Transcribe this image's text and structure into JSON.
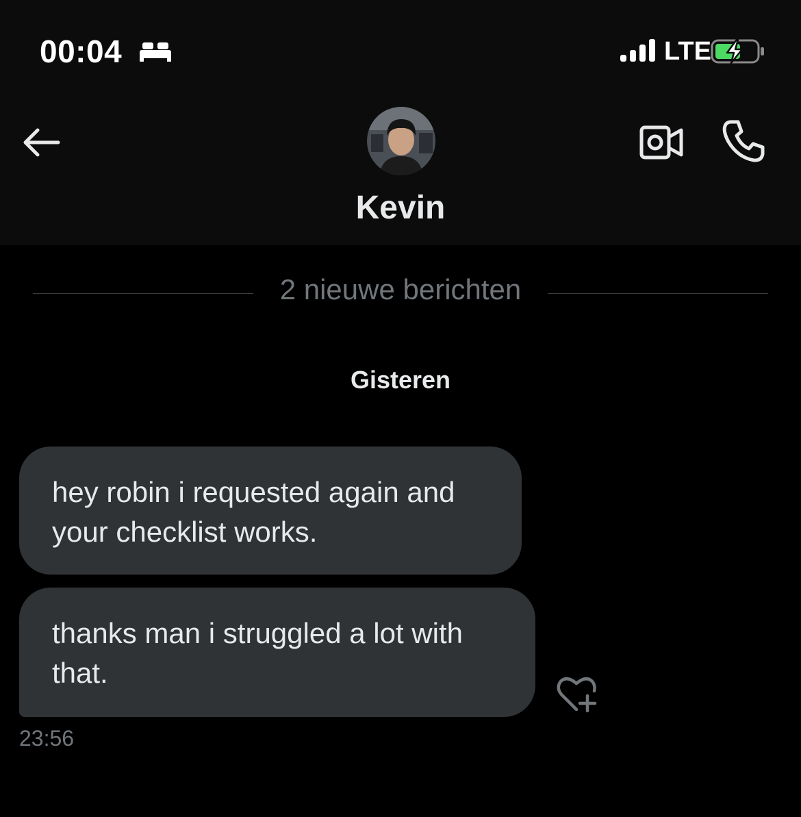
{
  "status_bar": {
    "time": "00:04",
    "sleep_icon": "bed-icon",
    "signal_icon": "cellular-signal-icon",
    "network": "LTE",
    "battery_icon": "battery-charging-icon",
    "battery_charging": true
  },
  "header": {
    "back_icon": "arrow-left-icon",
    "contact_name": "Kevin",
    "video_icon": "video-camera-icon",
    "call_icon": "phone-icon"
  },
  "conversation": {
    "new_messages_label": "2 nieuwe berichten",
    "date_label": "Gisteren",
    "messages": [
      {
        "text": "hey robin i requested again and your checklist works."
      },
      {
        "text": "thanks man i struggled a lot with that."
      }
    ],
    "last_timestamp": "23:56",
    "react_icon": "heart-plus-icon"
  },
  "colors": {
    "background": "#000000",
    "header_background": "#0c0c0c",
    "bubble": "#2f3336",
    "text_primary": "#e7e9ea",
    "text_secondary": "#71767b",
    "battery_charging": "#4cd964"
  }
}
